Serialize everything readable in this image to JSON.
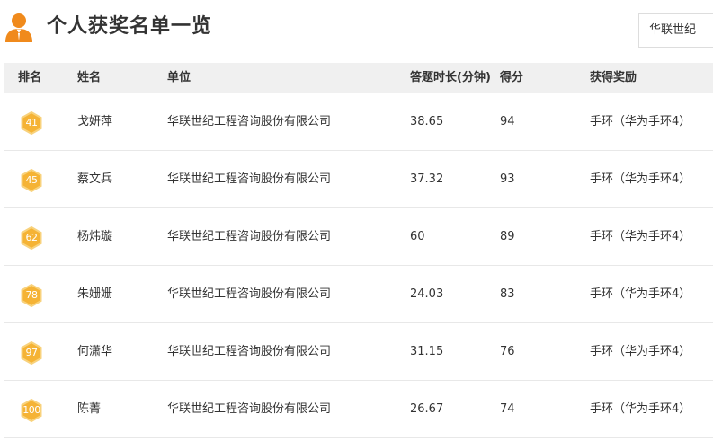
{
  "page": {
    "title": "个人获奖名单一览",
    "filter_value": "华联世纪"
  },
  "colors": {
    "accent": "#f08a1c",
    "badge_fill": "#f5b335",
    "badge_stroke": "#f8d27c",
    "header_bg": "#f0f0f0"
  },
  "table": {
    "columns": {
      "rank": "排名",
      "name": "姓名",
      "unit": "单位",
      "duration": "答题时长(分钟)",
      "score": "得分",
      "prize": "获得奖励"
    },
    "rows": [
      {
        "rank": "41",
        "name": "戈妍萍",
        "unit": "华联世纪工程咨询股份有限公司",
        "duration": "38.65",
        "score": "94",
        "prize": "手环（华为手环4）"
      },
      {
        "rank": "45",
        "name": "蔡文兵",
        "unit": "华联世纪工程咨询股份有限公司",
        "duration": "37.32",
        "score": "93",
        "prize": "手环（华为手环4）"
      },
      {
        "rank": "62",
        "name": "杨炜璇",
        "unit": "华联世纪工程咨询股份有限公司",
        "duration": "60",
        "score": "89",
        "prize": "手环（华为手环4）"
      },
      {
        "rank": "78",
        "name": "朱姗姗",
        "unit": "华联世纪工程咨询股份有限公司",
        "duration": "24.03",
        "score": "83",
        "prize": "手环（华为手环4）"
      },
      {
        "rank": "97",
        "name": "何潇华",
        "unit": "华联世纪工程咨询股份有限公司",
        "duration": "31.15",
        "score": "76",
        "prize": "手环（华为手环4）"
      },
      {
        "rank": "100",
        "name": "陈菁",
        "unit": "华联世纪工程咨询股份有限公司",
        "duration": "26.67",
        "score": "74",
        "prize": "手环（华为手环4）"
      }
    ]
  }
}
